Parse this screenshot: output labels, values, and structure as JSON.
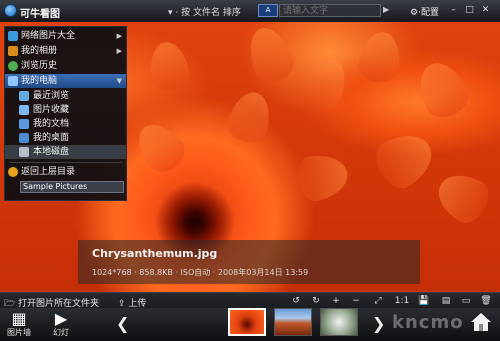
{
  "window": {
    "title": "可牛看图",
    "sort_label": "按 文件名 排序",
    "search": {
      "placeholder": "请输入文字",
      "scope": "A"
    },
    "config_label": "配置"
  },
  "sidebar": {
    "items": [
      {
        "label": "网络图片大全",
        "icon": "globe-icon",
        "has_arrow": true
      },
      {
        "label": "我的相册",
        "icon": "album-icon",
        "has_arrow": true
      },
      {
        "label": "浏览历史",
        "icon": "history-icon",
        "has_arrow": false
      },
      {
        "label": "我的电脑",
        "icon": "computer-icon",
        "has_arrow": true,
        "active": true
      },
      {
        "label": "最近浏览",
        "icon": "recent-icon",
        "sub": true
      },
      {
        "label": "图片收藏",
        "icon": "favorites-icon",
        "sub": true
      },
      {
        "label": "我的文档",
        "icon": "documents-icon",
        "sub": true
      },
      {
        "label": "我的桌面",
        "icon": "desktop-icon",
        "sub": true
      },
      {
        "label": "本地磁盘",
        "icon": "disk-icon",
        "sub": true,
        "hover": true
      }
    ],
    "up_label": "返回上层目录",
    "current_folder": "Sample Pictures"
  },
  "image_info": {
    "filename": "Chrysanthemum.jpg",
    "meta": "1024*768  ·  858.8KB  ·  ISO自动  ·  2008年03月14日 13:59"
  },
  "actions": {
    "open_folder": "打开图片所在文件夹",
    "upload": "上传"
  },
  "toolbar": {
    "rotate_left": "↺",
    "rotate_right": "↻",
    "zoom_in": "+",
    "zoom_out": "−",
    "fit": "⤢",
    "actual": "1:1",
    "save": "💾",
    "print": "▤",
    "monitor": "▭",
    "delete": "🗑"
  },
  "bottom": {
    "gallery_label": "图片墙",
    "slideshow_label": "幻灯",
    "watermark": "kncmo"
  },
  "colors": {
    "accent": "#2f5fa6",
    "photo_red": "#e0420e"
  }
}
